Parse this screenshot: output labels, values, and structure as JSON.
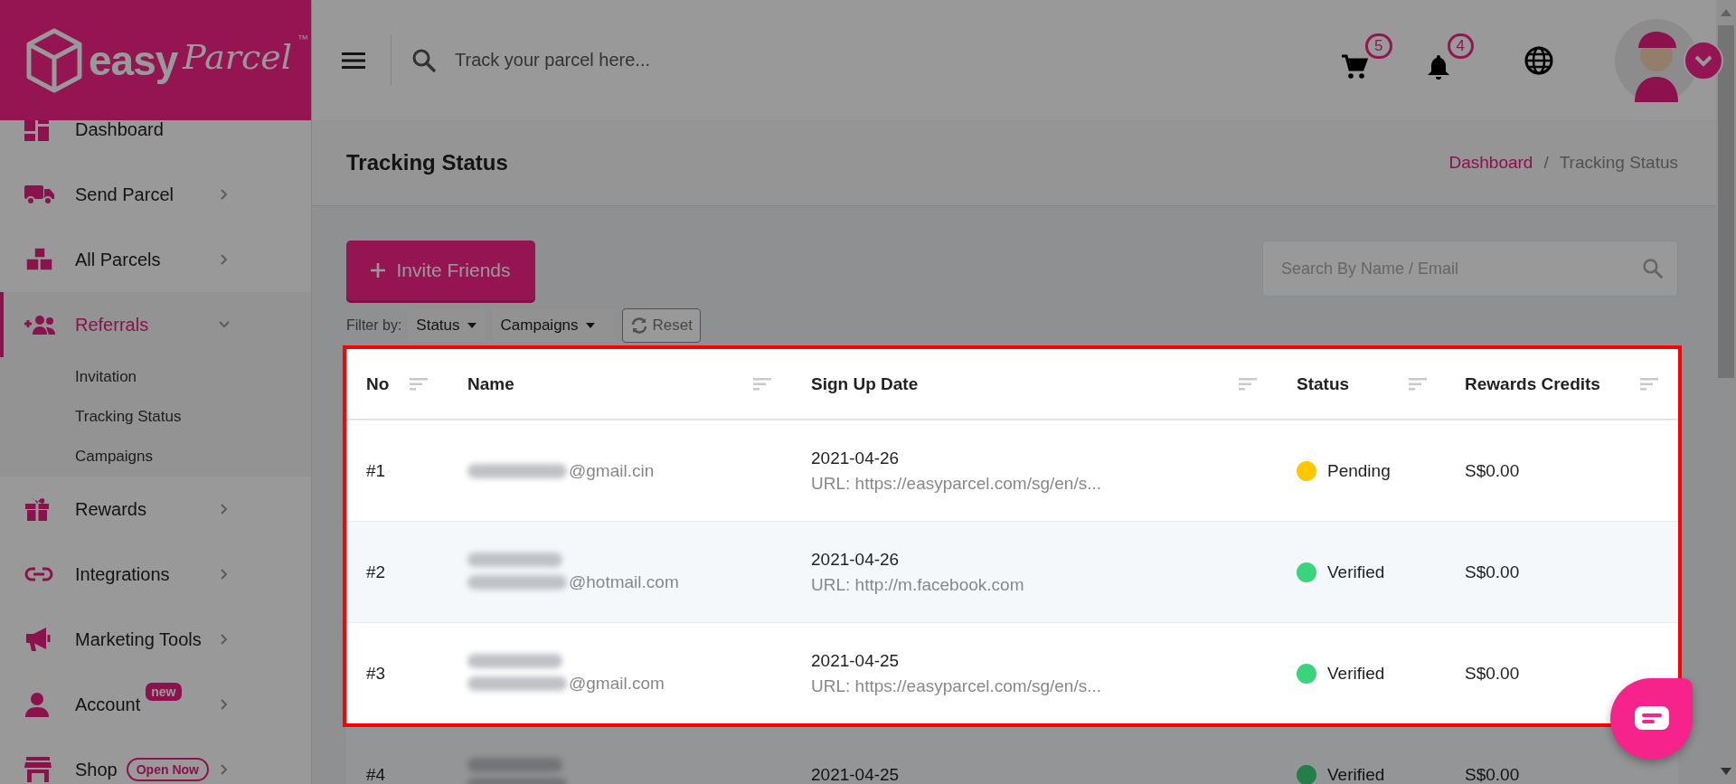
{
  "logo": {
    "word_1": "easy",
    "word_2": "Parcel",
    "trademark": "™"
  },
  "header": {
    "search": {
      "placeholder": "Track your parcel here..."
    },
    "cart_count": "5",
    "notification_count": "4"
  },
  "sidebar": {
    "items": [
      {
        "label": "Dashboard",
        "kind": "link",
        "selected": false
      },
      {
        "label": "Send Parcel",
        "kind": "menu",
        "selected": false,
        "expanded": false
      },
      {
        "label": "All Parcels",
        "kind": "menu",
        "selected": false,
        "expanded": false
      },
      {
        "label": "Referrals",
        "kind": "menu",
        "selected": true,
        "expanded": true,
        "children": [
          {
            "label": "Invitation",
            "selected": false
          },
          {
            "label": "Tracking Status",
            "selected": false
          },
          {
            "label": "Campaigns",
            "selected": false
          }
        ]
      },
      {
        "label": "Rewards",
        "kind": "menu",
        "selected": false,
        "expanded": false
      },
      {
        "label": "Integrations",
        "kind": "menu",
        "selected": false,
        "expanded": false
      },
      {
        "label": "Marketing Tools",
        "kind": "menu",
        "selected": false,
        "expanded": false
      },
      {
        "label": "Account",
        "kind": "menu",
        "selected": false,
        "expanded": false,
        "badge": {
          "text": "new",
          "kind": "filled"
        }
      },
      {
        "label": "Shop",
        "kind": "menu",
        "selected": false,
        "expanded": false,
        "badge": {
          "text": "Open Now",
          "kind": "outline"
        }
      }
    ]
  },
  "page": {
    "title": "Tracking Status",
    "breadcrumb": [
      {
        "label": "Dashboard",
        "kind": "link"
      },
      {
        "label": "Tracking Status",
        "kind": "current"
      }
    ],
    "breadcrumb_separator": "/"
  },
  "invite_button": "Invite Friends",
  "search": {
    "placeholder": "Search By Name / Email"
  },
  "filter": {
    "label": "Filter by:",
    "dropdowns": [
      "Status",
      "Campaigns"
    ],
    "reset": "Reset"
  },
  "table": {
    "columns": [
      "No",
      "Name",
      "Sign Up Date",
      "Status",
      "Rewards Credits"
    ],
    "rows": [
      {
        "no": "#1",
        "name_redacted": false,
        "email_domain": "@gmail.cin",
        "date": "2021-04-26",
        "url": "URL: https://easyparcel.com/sg/en/s...",
        "status": {
          "label": "Pending",
          "color": "#ffc700"
        },
        "credits": "S$0.00",
        "highlighted": true
      },
      {
        "no": "#2",
        "name_redacted": true,
        "email_domain": "@hotmail.com",
        "date": "2021-04-26",
        "url": "URL: http://m.facebook.com",
        "status": {
          "label": "Verified",
          "color": "#3ad47c"
        },
        "credits": "S$0.00",
        "highlighted": true
      },
      {
        "no": "#3",
        "name_redacted": true,
        "email_domain": "@gmail.com",
        "date": "2021-04-25",
        "url": "URL: https://easyparcel.com/sg/en/s...",
        "status": {
          "label": "Verified",
          "color": "#3ad47c"
        },
        "credits": "S$0.00",
        "highlighted": true
      },
      {
        "no": "#4",
        "name_redacted": true,
        "date": "2021-04-25",
        "status": {
          "label": "Verified",
          "color": "#237f4a"
        },
        "credits": "S$0.00",
        "highlighted": false
      }
    ]
  },
  "tour_overlay": true
}
